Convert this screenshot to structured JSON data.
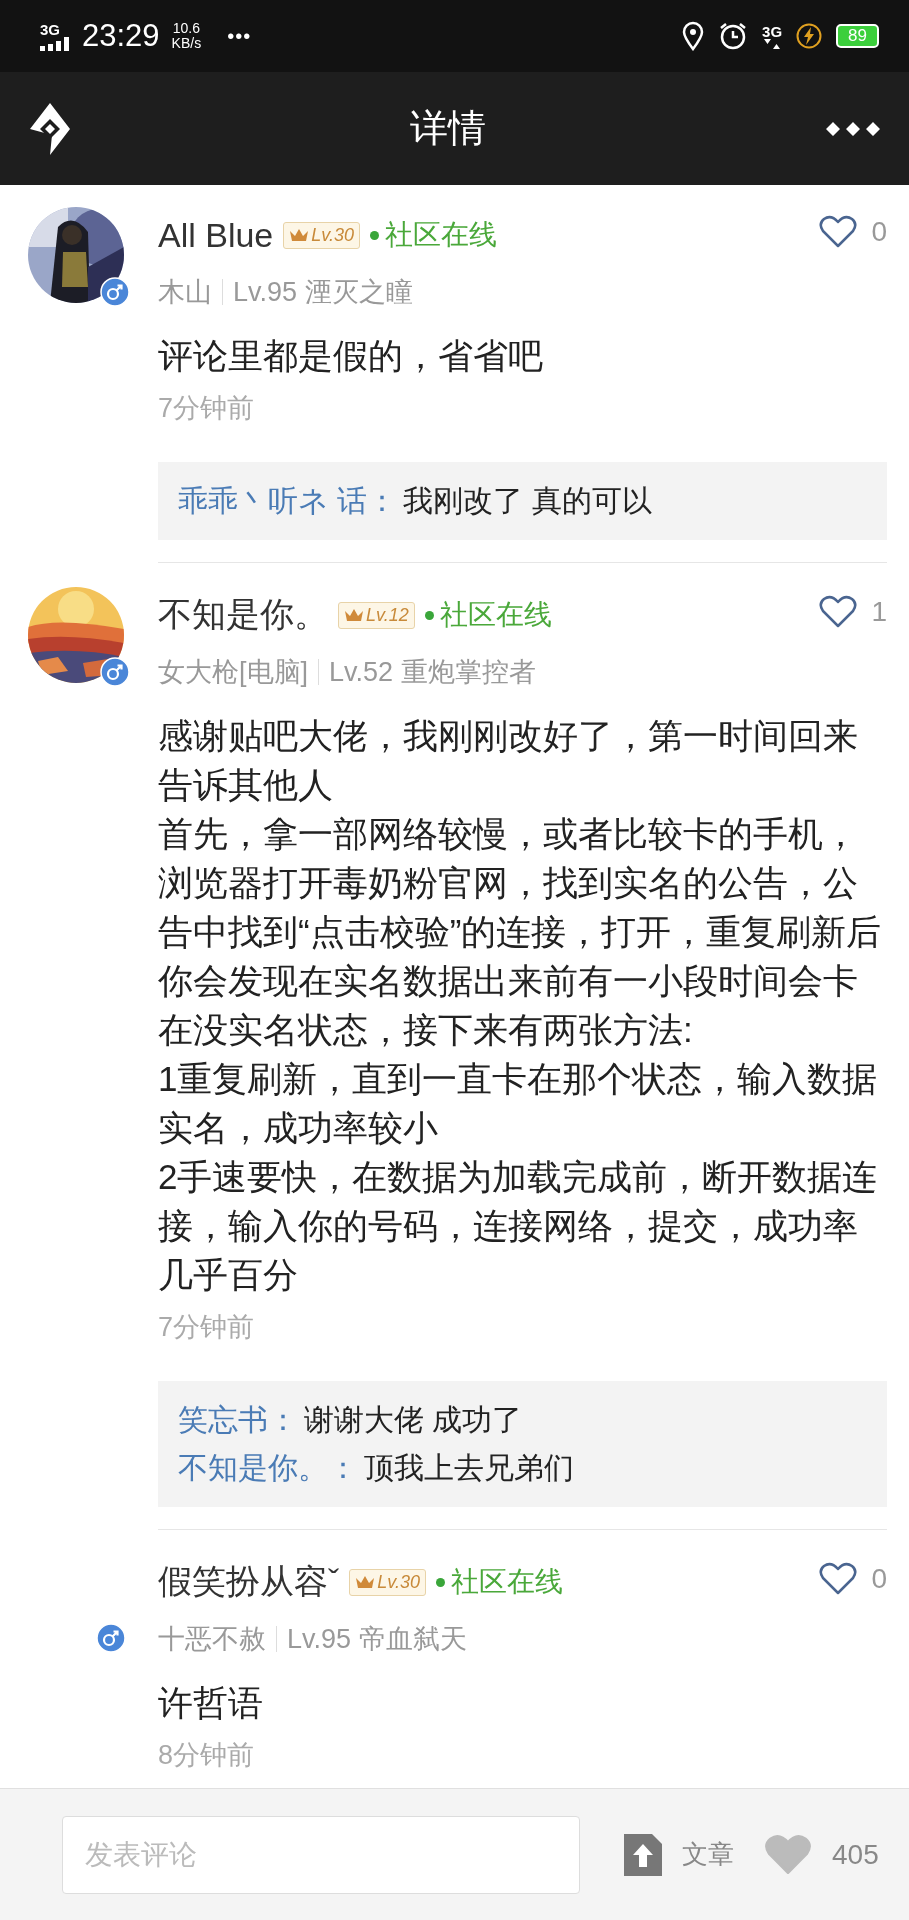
{
  "status_bar": {
    "network": "3G",
    "time": "23:29",
    "speed_value": "10.6",
    "speed_unit": "KB/s",
    "more": "•••",
    "data_type": "3G",
    "battery": "89"
  },
  "header": {
    "title": "详情"
  },
  "comments": [
    {
      "avatar": {
        "kind": "picture"
      },
      "name": "All Blue",
      "level_badge": "Lv.30",
      "online": "社区在线",
      "server": "木山",
      "character": "Lv.95 湮灭之瞳",
      "likes": "0",
      "body": [
        "评论里都是假的，省省吧"
      ],
      "time": "7分钟前",
      "replies": [
        {
          "author": "乖乖丶听ネ 话：",
          "text": "我刚改了 真的可以"
        }
      ]
    },
    {
      "avatar": {
        "kind": "picture"
      },
      "name": "不知是你。",
      "level_badge": "Lv.12",
      "online": "社区在线",
      "server": "女大枪[电脑]",
      "character": "Lv.52 重炮掌控者",
      "likes": "1",
      "body": [
        "感谢贴吧大佬，我刚刚改好了，第一时间回来告诉其他人",
        "首先，拿一部网络较慢，或者比较卡的手机，浏览器打开毒奶粉官网，找到实名的公告，公告中找到“点击校验”的连接，打开，重复刷新后你会发现在实名数据出来前有一小段时间会卡在没实名状态，接下来有两张方法:",
        "1重复刷新，直到一直卡在那个状态，输入数据实名，成功率较小",
        "2手速要快，在数据为加载完成前，断开数据连接，输入你的号码，连接网络，提交，成功率几乎百分"
      ],
      "time": "7分钟前",
      "replies": [
        {
          "author": "笑忘书：",
          "text": "谢谢大佬 成功了"
        },
        {
          "author": "不知是你。：",
          "text": "顶我上去兄弟们"
        }
      ]
    },
    {
      "name": "假笑扮从容ˇ",
      "level_badge": "Lv.30",
      "online": "社区在线",
      "server": "十恶不赦",
      "character": "Lv.95 帝血弑天",
      "likes": "0",
      "body": [
        "许哲语"
      ],
      "time": "8分钟前"
    }
  ],
  "bottom_bar": {
    "comment_field": {
      "placeholder": "发表评论"
    },
    "article_label": "文章",
    "like_count": "405"
  }
}
